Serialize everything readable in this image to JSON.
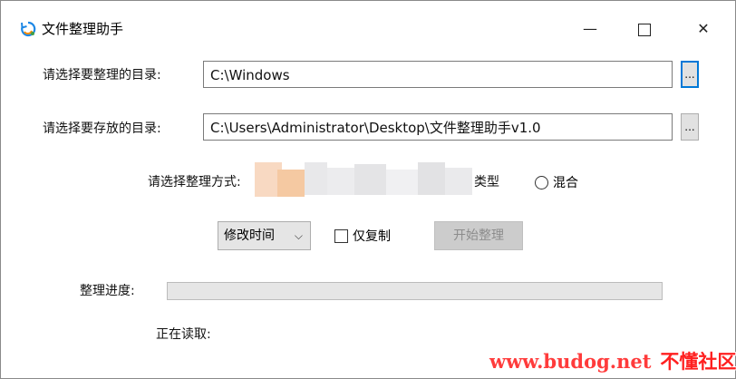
{
  "window": {
    "title": "文件整理助手",
    "minimize_glyph": "—",
    "close_glyph": "✕"
  },
  "source": {
    "label": "请选择要整理的目录:",
    "value": "C:\\Windows",
    "browse_label": "..."
  },
  "target": {
    "label": "请选择要存放的目录:",
    "value": "C:\\Users\\Administrator\\Desktop\\文件整理助手v1.0",
    "browse_label": "..."
  },
  "mode": {
    "label": "请选择整理方式:",
    "type_partial": "类型",
    "mix_label": "混合"
  },
  "controls": {
    "sort_select": "修改时间",
    "copy_only_label": "仅复制",
    "copy_only_checked": false,
    "start_button": "开始整理",
    "start_enabled": false
  },
  "progress": {
    "label": "整理进度:",
    "value": 0
  },
  "status": {
    "label": "正在读取:"
  },
  "watermark": {
    "url": "www.budog.net",
    "site": "不懂社区"
  },
  "colors": {
    "accent": "#0078d7",
    "watermark": "#ff2020"
  }
}
